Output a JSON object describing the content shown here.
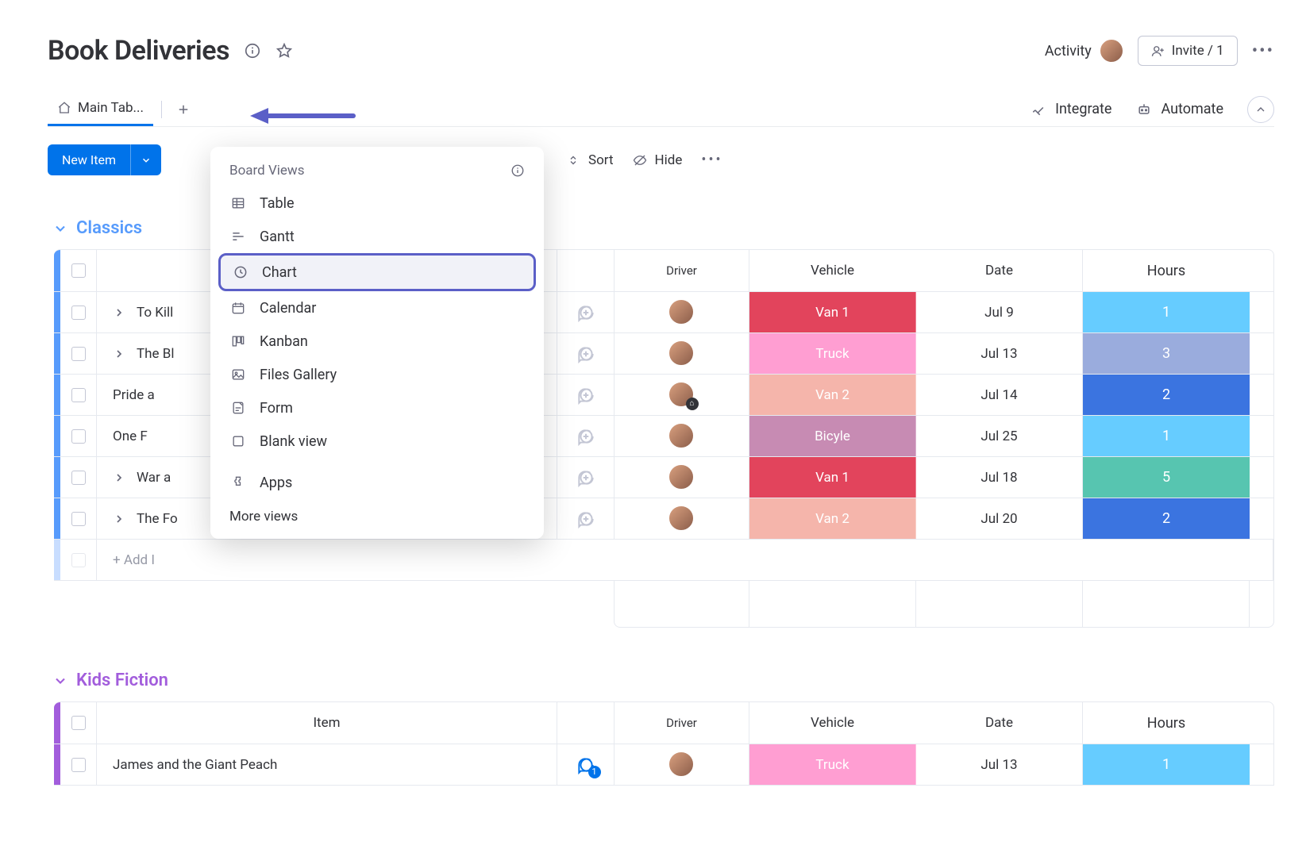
{
  "header": {
    "title": "Book Deliveries",
    "activity_label": "Activity",
    "invite_label": "Invite / 1"
  },
  "tabs": {
    "main_label": "Main Tab...",
    "integrate_label": "Integrate",
    "automate_label": "Automate"
  },
  "toolbar": {
    "new_item_label": "New Item",
    "sort_label": "Sort",
    "hide_label": "Hide"
  },
  "views_menu": {
    "header": "Board Views",
    "items": [
      {
        "label": "Table"
      },
      {
        "label": "Gantt"
      },
      {
        "label": "Chart"
      },
      {
        "label": "Calendar"
      },
      {
        "label": "Kanban"
      },
      {
        "label": "Files Gallery"
      },
      {
        "label": "Form"
      },
      {
        "label": "Blank view"
      }
    ],
    "apps_label": "Apps",
    "more_label": "More views"
  },
  "columns": {
    "item": "Item",
    "driver": "Driver",
    "vehicle": "Vehicle",
    "date": "Date",
    "hours": "Hours"
  },
  "groups": [
    {
      "name": "Classics",
      "color": "#579bfc",
      "rows": [
        {
          "item": "To Kill",
          "has_sub": true,
          "vehicle": "Van 1",
          "vehicle_color": "#e2445c",
          "date": "Jul 9",
          "hours": "1",
          "hours_color": "#66ccff"
        },
        {
          "item": "The Bl",
          "has_sub": true,
          "vehicle": "Truck",
          "vehicle_color": "#ff9ed2",
          "date": "Jul 13",
          "hours": "3",
          "hours_color": "#9aacdd"
        },
        {
          "item": "Pride a",
          "has_sub": false,
          "vehicle": "Van 2",
          "vehicle_color": "#f5b5ab",
          "date": "Jul 14",
          "hours": "2",
          "hours_color": "#3b74e0",
          "driver_badge": true
        },
        {
          "item": "One F",
          "has_sub": false,
          "vehicle": "Bicyle",
          "vehicle_color": "#c78bb3",
          "date": "Jul 25",
          "hours": "1",
          "hours_color": "#66ccff"
        },
        {
          "item": "War a",
          "has_sub": true,
          "vehicle": "Van 1",
          "vehicle_color": "#e2445c",
          "date": "Jul 18",
          "hours": "5",
          "hours_color": "#57c5b0"
        },
        {
          "item": "The Fo",
          "has_sub": true,
          "vehicle": "Van 2",
          "vehicle_color": "#f5b5ab",
          "date": "Jul 20",
          "hours": "2",
          "hours_color": "#3b74e0"
        }
      ],
      "add_label": "+ Add I"
    },
    {
      "name": "Kids Fiction",
      "color": "#a25ddc",
      "rows": [
        {
          "item": "James and the Giant Peach",
          "has_sub": false,
          "vehicle": "Truck",
          "vehicle_color": "#ff9ed2",
          "date": "Jul 13",
          "hours": "1",
          "hours_color": "#66ccff",
          "chat_active": true,
          "chat_count": "1"
        }
      ]
    }
  ]
}
